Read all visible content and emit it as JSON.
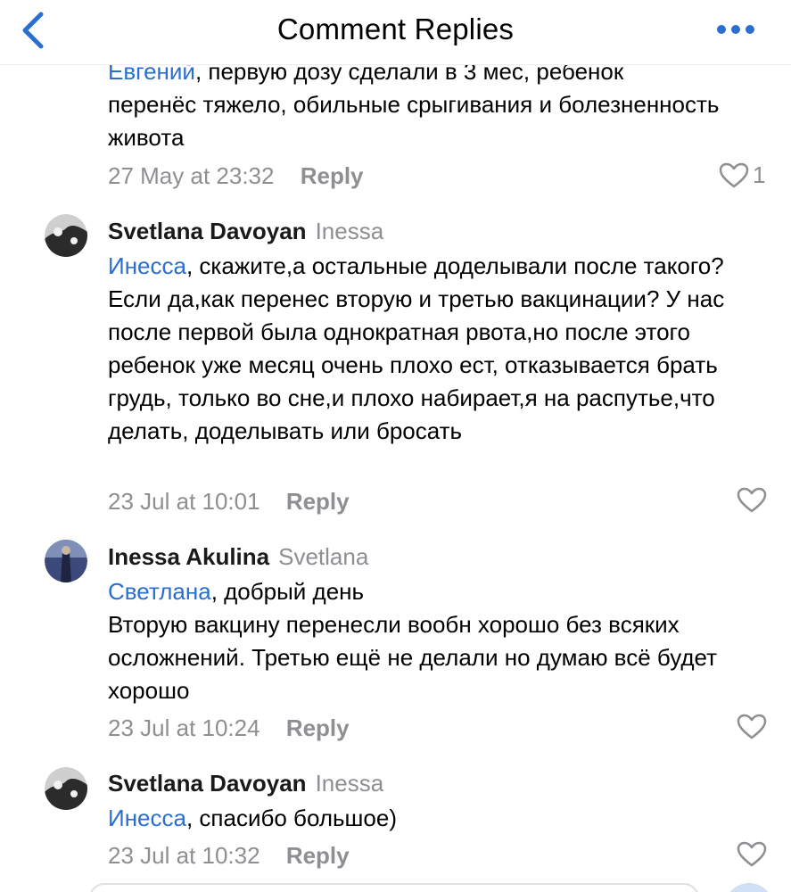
{
  "header": {
    "title": "Comment Replies",
    "back_icon": "chevron-left-icon",
    "more_icon": "more-horizontal-icon",
    "accent_color": "#2a6fd0"
  },
  "partial_comment": {
    "mention": "Евгений",
    "text_line1": ", первую дозу сделали в 3 мес, ребенок",
    "text_rest": "перенёс тяжело, обильные срыгивания и болезненность живота",
    "time": "27 May at 23:32",
    "reply_label": "Reply",
    "likes": "1"
  },
  "comments": [
    {
      "author": "Svetlana Davoyan",
      "reply_to": "Inessa",
      "mention": "Инесса",
      "text": ", скажите,а остальные доделывали после такого? Если да,как перенес вторую и третью вакцинации? У нас после первой была однократная рвота,но после этого ребенок уже месяц очень плохо ест, отказывается брать грудь, только во сне,и плохо набирает,я на распутье,что делать, доделывать или бросать",
      "time": "23 Jul at 10:01",
      "reply_label": "Reply"
    },
    {
      "author": "Inessa Akulina",
      "reply_to": "Svetlana",
      "mention": "Светлана",
      "text_line1": ", добрый день",
      "text_rest": "Вторую вакцину перенесли вообн хорошо без всяких  осложнений. Третью ещё не делали но думаю всё будет хорошо",
      "time": "23 Jul at 10:24",
      "reply_label": "Reply"
    },
    {
      "author": "Svetlana Davoyan",
      "reply_to": "Inessa",
      "mention": "Инесса",
      "text": ", спасибо большое)",
      "time": "23 Jul at 10:32",
      "reply_label": "Reply"
    }
  ]
}
